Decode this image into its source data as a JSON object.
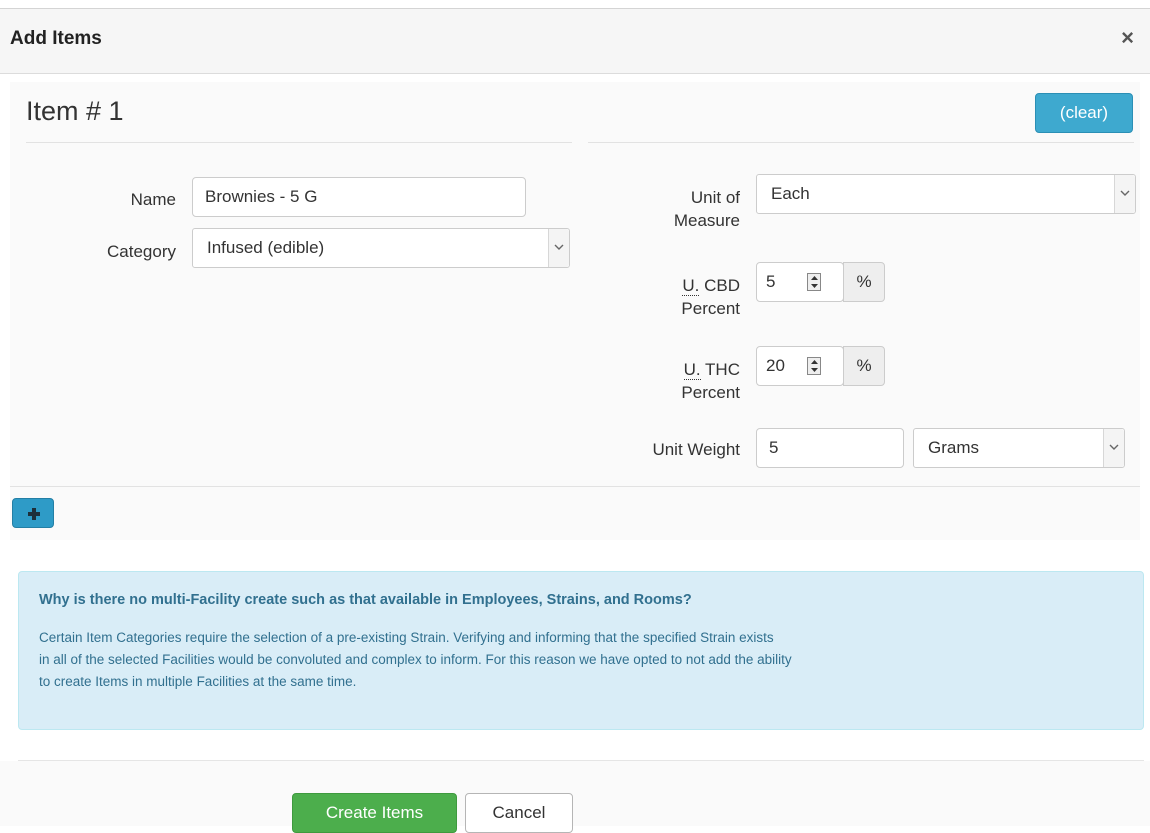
{
  "modal": {
    "title": "Add Items",
    "close": "×"
  },
  "item": {
    "heading": "Item # 1",
    "clear_label": "(clear)",
    "name": {
      "label": "Name",
      "value": "Brownies - 5 G"
    },
    "category": {
      "label": "Category",
      "value": "Infused (edible)"
    },
    "unit_of_measure": {
      "label_line1": "Unit of",
      "label_line2": "Measure",
      "value": "Each"
    },
    "cbd_percent": {
      "abbr": "U.",
      "label_line1": "CBD",
      "label_line2": "Percent",
      "value": "5",
      "addon": "%"
    },
    "thc_percent": {
      "abbr": "U.",
      "label_line1": "THC",
      "label_line2": "Percent",
      "value": "20",
      "addon": "%"
    },
    "unit_weight": {
      "label": "Unit Weight",
      "value": "5",
      "unit_value": "Grams"
    },
    "add_icon": "plus-icon"
  },
  "info": {
    "heading": "Why is there no multi-Facility create such as that available in Employees, Strains, and Rooms?",
    "line1": "Certain Item Categories require the selection of a pre-existing Strain. Verifying and informing that the specified Strain exists",
    "line2": "in all of the selected Facilities would be convoluted and complex to inform. For this reason we have opted to not add the ability",
    "line3": "to create Items in multiple Facilities at the same time."
  },
  "footer": {
    "create_label": "Create Items",
    "cancel_label": "Cancel"
  },
  "colors": {
    "primary_info": "#3ea9cf",
    "success": "#4cae4c",
    "info_bg": "#d9edf7",
    "info_text": "#31708f"
  }
}
